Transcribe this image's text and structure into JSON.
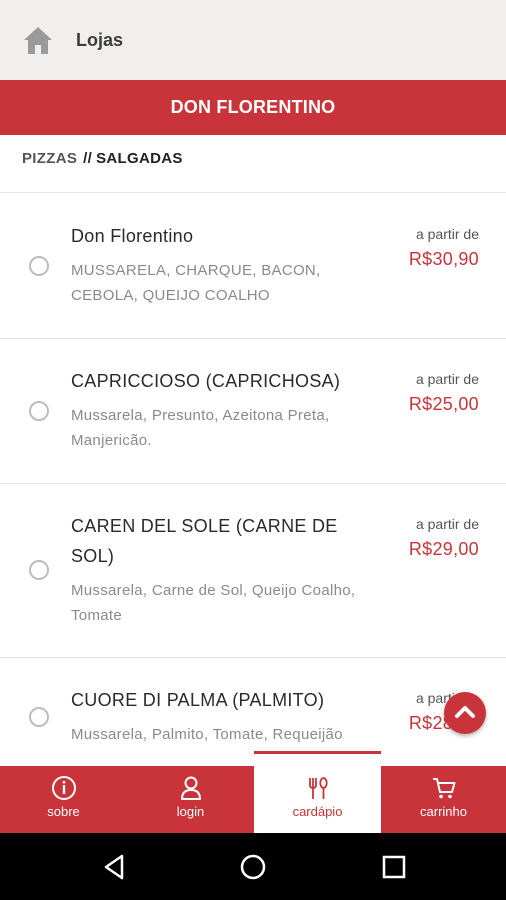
{
  "header": {
    "title": "Lojas",
    "icon": "home-icon"
  },
  "store": {
    "name": "DON FLORENTINO"
  },
  "breadcrumb": {
    "category": "PIZZAS",
    "separator": "//",
    "subcategory": "SALGADAS"
  },
  "items": [
    {
      "name": "Don Florentino",
      "description": "MUSSARELA, CHARQUE, BACON, CEBOLA, QUEIJO COALHO",
      "from_label": "a partir de",
      "price": "R$30,90"
    },
    {
      "name": "CAPRICCIOSO (CAPRICHOSA)",
      "description": "Mussarela, Presunto, Azeitona Preta, Manjericão.",
      "from_label": "a partir de",
      "price": "R$25,00"
    },
    {
      "name": "CAREN DEL SOLE (CARNE DE SOL)",
      "description": "Mussarela, Carne de Sol, Queijo Coalho, Tomate",
      "from_label": "a partir de",
      "price": "R$29,00"
    },
    {
      "name": "CUORE DI PALMA (PALMITO)",
      "description": "Mussarela, Palmito, Tomate, Requeijão",
      "from_label": "a partir de",
      "price": "R$28,00"
    }
  ],
  "tabs": [
    {
      "label": "sobre",
      "icon": "info-icon"
    },
    {
      "label": "login",
      "icon": "user-icon"
    },
    {
      "label": "cardápio",
      "icon": "cutlery-icon",
      "active": true
    },
    {
      "label": "carrinho",
      "icon": "cart-icon"
    }
  ],
  "colors": {
    "brand": "#c8343a",
    "topbar": "#f0efed",
    "price": "#c8343a"
  }
}
